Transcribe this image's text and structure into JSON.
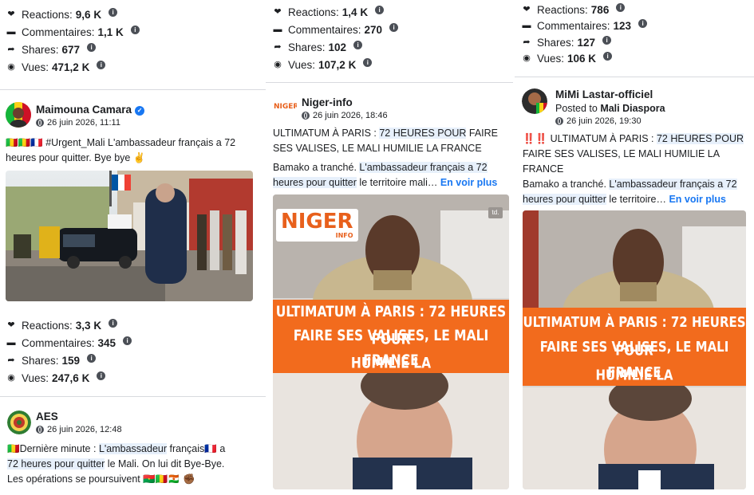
{
  "col1": {
    "stats_top": [
      {
        "label": "Reactions:",
        "value": "9,6 K"
      },
      {
        "label": "Commentaires:",
        "value": "1,1 K"
      },
      {
        "label": "Shares:",
        "value": "677"
      },
      {
        "label": "Vues:",
        "value": "471,2 K"
      }
    ],
    "post1": {
      "author": "Maimouna Camara",
      "date": "26 juin 2026, 11:11",
      "text": "#Urgent_Mali L'ambassadeur français a 72 heures pour quitter. Bye bye ✌️",
      "flags": "🇲🇱🇲🇱🇫🇷"
    },
    "stats_bottom": [
      {
        "label": "Reactions:",
        "value": "3,3 K"
      },
      {
        "label": "Commentaires:",
        "value": "345"
      },
      {
        "label": "Shares:",
        "value": "159"
      },
      {
        "label": "Vues:",
        "value": "247,6 K"
      }
    ],
    "post2": {
      "author": "AES",
      "date": "26 juin 2026, 12:48",
      "text_a": "Dernière minute : ",
      "text_hl1": "L'ambassadeur",
      "text_b": " français",
      "text_c": " a",
      "text_hl2": "72 heures pour quitter",
      "text_d": " le Mali. On lui dit Bye-Bye.",
      "text_e": "Les opérations se poursuivent 🇧🇫🇲🇱🇳🇪 ✊🏾"
    }
  },
  "col2": {
    "stats": [
      {
        "label": "Reactions:",
        "value": "1,4 K"
      },
      {
        "label": "Commentaires:",
        "value": "270"
      },
      {
        "label": "Shares:",
        "value": "102"
      },
      {
        "label": "Vues:",
        "value": "107,2 K"
      }
    ],
    "post": {
      "author": "Niger-info",
      "date": "26 juin 2026, 18:46",
      "headline_a": "ULTIMATUM À PARIS : ",
      "headline_hl": "72 HEURES POUR",
      "headline_b": " FAIRE",
      "headline_c": "SES VALISES, LE MALI HUMILIE LA FRANCE",
      "body_a": "Bamako a tranché. ",
      "body_hl1": "L'ambassadeur français a 72",
      "body_hl2": "heures pour quitter",
      "body_b": " le territoire mali… ",
      "see_more": "En voir plus",
      "logo_text": "NIGER",
      "logo_sub": "INFO",
      "watermark": "td.",
      "banner": [
        "ULTIMATUM À PARIS : 72 HEURES POUR",
        "FAIRE SES VALISES, LE MALI HUMILIE LA",
        "FRANCE"
      ]
    }
  },
  "col3": {
    "stats": [
      {
        "label": "Reactions:",
        "value": "786"
      },
      {
        "label": "Commentaires:",
        "value": "123"
      },
      {
        "label": "Shares:",
        "value": "127"
      },
      {
        "label": "Vues:",
        "value": "106 K"
      }
    ],
    "post": {
      "author": "MiMi Lastar-officiel",
      "posted_to_label": "Posted to ",
      "group": "Mali Diaspora",
      "date": "26 juin 2026, 19:30",
      "headline_a": "‼️‼️ ULTIMATUM À PARIS : ",
      "headline_hl": "72 HEURES POUR",
      "headline_b": "FAIRE SES VALISES, LE MALI HUMILIE LA",
      "headline_c": "FRANCE",
      "body_a": "Bamako a tranché. ",
      "body_hl1": "L'ambassadeur français a 72",
      "body_hl2": "heures pour quitter",
      "body_b": " le territoire… ",
      "see_more": "En voir plus",
      "banner": [
        "ULTIMATUM À PARIS : 72 HEURES POUR",
        "FAIRE SES VALISES, LE MALI HUMILIE LA",
        "FRANCE"
      ]
    }
  },
  "colors": {
    "accent": "#1877f2",
    "banner": "#f26b1d",
    "highlight": "#e7f0fb"
  }
}
